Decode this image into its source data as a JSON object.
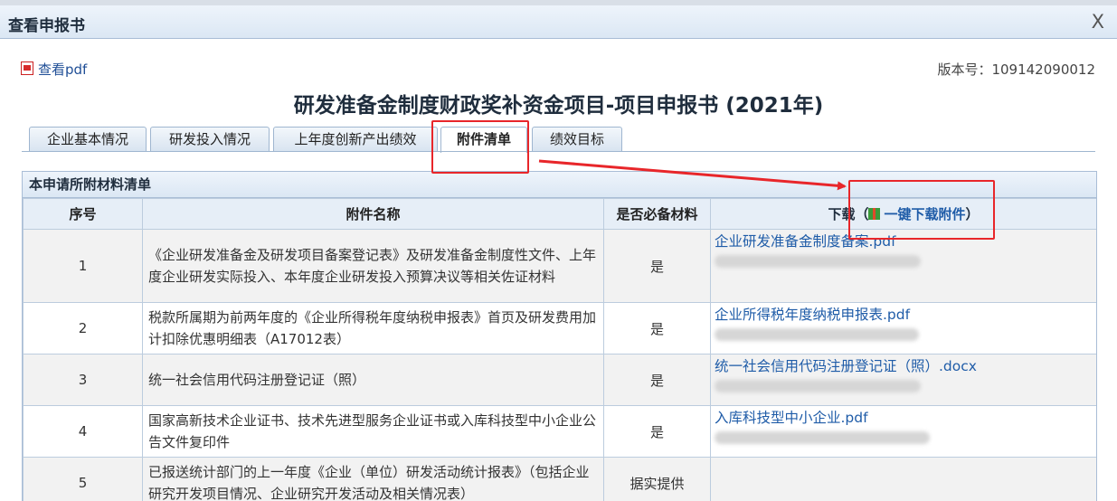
{
  "window": {
    "title": "查看申报书",
    "close_glyph": "X"
  },
  "toolbar": {
    "pdf_label": "查看pdf",
    "version_label": "版本号：109142090012"
  },
  "document": {
    "title": "研发准备金制度财政奖补资金项目-项目申报书 (2021年)"
  },
  "tabs": [
    {
      "label": "企业基本情况"
    },
    {
      "label": "研发投入情况"
    },
    {
      "label": "上年度创新产出绩效"
    },
    {
      "label": "附件清单",
      "active": true
    },
    {
      "label": "绩效目标"
    }
  ],
  "panel": {
    "title": "本申请所附材料清单",
    "columns": {
      "index": "序号",
      "name": "附件名称",
      "required": "是否必备材料",
      "download_prefix": "下载（",
      "download_link": "一键下载附件",
      "download_suffix": "）"
    },
    "rows": [
      {
        "index": "1",
        "name": "《企业研发准备金及研发项目备案登记表》及研发准备金制度性文件、上年度企业研发实际投入、本年度企业研发投入预算决议等相关佐证材料",
        "required": "是",
        "file": "企业研发准备金制度备案.pdf"
      },
      {
        "index": "2",
        "name": "税款所属期为前两年度的《企业所得税年度纳税申报表》首页及研发费用加计扣除优惠明细表（A17012表）",
        "required": "是",
        "file": "企业所得税年度纳税申报表.pdf"
      },
      {
        "index": "3",
        "name": "统一社会信用代码注册登记证（照）",
        "required": "是",
        "file": "统一社会信用代码注册登记证（照）.docx"
      },
      {
        "index": "4",
        "name": "国家高新技术企业证书、技术先进型服务企业证书或入库科技型中小企业公告文件复印件",
        "required": "是",
        "file": "入库科技型中小企业.pdf"
      },
      {
        "index": "5",
        "name": "已报送统计部门的上一年度《企业（单位）研发活动统计报表》（包括企业研究开发项目情况、企业研究开发活动及相关情况表）",
        "required": "据实提供",
        "file": ""
      }
    ]
  }
}
